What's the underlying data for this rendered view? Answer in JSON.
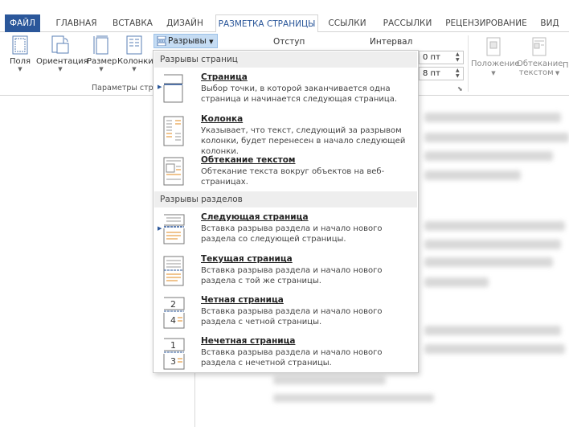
{
  "tabs": [
    "ФАЙЛ",
    "ГЛАВНАЯ",
    "ВСТАВКА",
    "ДИЗАЙН",
    "РАЗМЕТКА СТРАНИЦЫ",
    "ССЫЛКИ",
    "РАССЫЛКИ",
    "РЕЦЕНЗИРОВАНИЕ",
    "ВИД"
  ],
  "active_tab": "РАЗМЕТКА СТРАНИЦЫ",
  "ribbon": {
    "margins_label": "Поля",
    "orientation_label": "Ориентация",
    "size_label": "Размер",
    "columns_label": "Колонки",
    "group_page_setup": "Параметры стран",
    "breaks_label": "Разрывы",
    "indent_label": "Отступ",
    "spacing_label": "Интервал",
    "spacing_before": "0 пт",
    "spacing_after": "8 пт",
    "position_label": "Положение",
    "wrap_label": "Обтекание",
    "wrap_label2": "текстом",
    "extra_label": "П"
  },
  "menu": {
    "page_breaks_header": "Разрывы страниц",
    "section_breaks_header": "Разрывы разделов",
    "items": [
      {
        "title": "Страница",
        "desc": "Выбор точки, в которой заканчивается одна страница и начинается следующая страница."
      },
      {
        "title": "Колонка",
        "desc": "Указывает, что текст, следующий за разрывом колонки, будет перенесен в начало следующей колонки."
      },
      {
        "title": "Обтекание текстом",
        "desc": "Обтекание текста вокруг объектов на веб-страницах."
      },
      {
        "title": "Следующая страница",
        "desc": "Вставка разрыва раздела и начало нового раздела со следующей страницы."
      },
      {
        "title": "Текущая страница",
        "desc": "Вставка разрыва раздела и начало нового раздела с той же страницы."
      },
      {
        "title": "Четная страница",
        "desc": "Вставка разрыва раздела и начало нового раздела с четной страницы."
      },
      {
        "title": "Нечетная страница",
        "desc": "Вставка разрыва раздела и начало нового раздела с нечетной страницы."
      }
    ]
  },
  "icons": {
    "page": "page-break-icon",
    "column": "column-break-icon",
    "wrap": "text-wrap-break-icon",
    "next": "next-page-section-icon",
    "continuous": "continuous-section-icon",
    "even": "even-page-section-icon",
    "odd": "odd-page-section-icon"
  },
  "icon_digits": {
    "even_top": "2",
    "even_bottom": "4",
    "odd_top": "1",
    "odd_bottom": "3"
  },
  "colors": {
    "accent": "#2b579a",
    "icon_orange": "#e08a1e"
  }
}
